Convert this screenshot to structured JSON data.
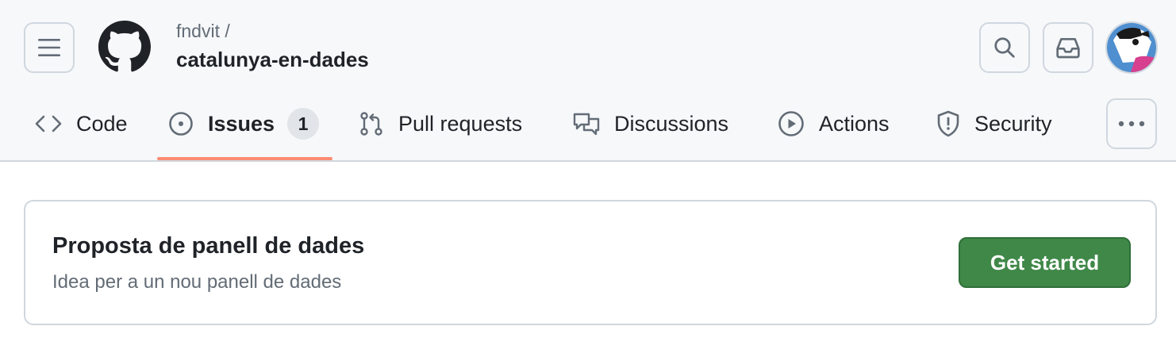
{
  "header": {
    "owner": "fndvit /",
    "repo": "catalunya-en-dades"
  },
  "tabs": [
    {
      "label": "Code",
      "icon": "code-icon"
    },
    {
      "label": "Issues",
      "icon": "issue-opened-icon",
      "count": "1",
      "selected": true
    },
    {
      "label": "Pull requests",
      "icon": "git-pull-request-icon"
    },
    {
      "label": "Discussions",
      "icon": "comment-discussion-icon"
    },
    {
      "label": "Actions",
      "icon": "play-icon"
    },
    {
      "label": "Security",
      "icon": "shield-icon"
    }
  ],
  "banner": {
    "title": "Proposta de panell de dades",
    "description": "Idea per a un nou panell de dades",
    "button_label": "Get started"
  },
  "colors": {
    "header_bg": "#f6f8fa",
    "selected_tab_underline": "#fd8c73",
    "primary_button": "#3f8848",
    "text": "#1f2328",
    "muted_text": "#636c76"
  }
}
